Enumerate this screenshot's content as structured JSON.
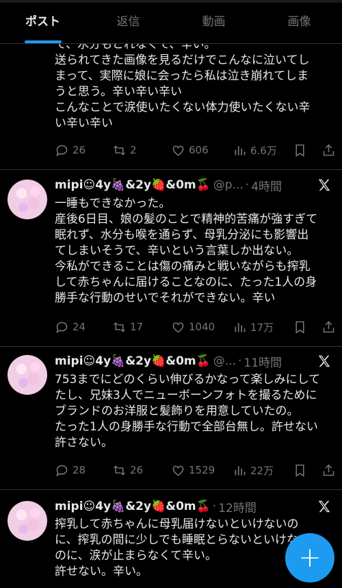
{
  "tabs": [
    {
      "label": "ポスト",
      "active": true
    },
    {
      "label": "返信"
    },
    {
      "label": "動画"
    },
    {
      "label": "画像"
    }
  ],
  "accent_color": "#1d9bf0",
  "posts": [
    {
      "text_lines": [
        "て、水分もとれなくて、辛い。",
        "送られてきた画像を見るだけでこんなに泣いてし",
        "まって、実際に娘に会ったら私は泣き崩れてしま",
        "うと思う。辛い辛い辛い",
        "こんなことで涙使いたくない体力使いたくない辛",
        "い辛い辛い"
      ],
      "replies": "26",
      "reposts": "2",
      "likes": "606",
      "views": "6.6万"
    },
    {
      "name": "mipi☺4y🍇&2y🍓&0m🍒",
      "handle": "@p...",
      "time": "4時間",
      "text_lines": [
        "一睡もできなかった。",
        "産後6日目、娘の髪のことで精神的苦痛が強すぎて",
        "眠れず、水分も喉を通らず、母乳分泌にも影響出",
        "てしまいそうで、辛いという言葉しか出ない。",
        "今私ができることは傷の痛みと戦いながらも搾乳",
        "して赤ちゃんに届けることなのに、たった1人の身",
        "勝手な行動のせいでそれができない。辛い"
      ],
      "replies": "24",
      "reposts": "17",
      "likes": "1040",
      "views": "17万"
    },
    {
      "name": "mipi☺4y🍇&2y🍓&0m🍒",
      "handle": "@...",
      "time": "11時間",
      "text_lines": [
        "753までにどのくらい伸びるかなって楽しみにして",
        "たし、兄妹3人でニューボーンフォトを撮るために",
        "ブランドのお洋服と髪飾りを用意していたの。",
        "たった1人の身勝手な行動で全部台無し。許せない",
        "許さない。"
      ],
      "replies": "28",
      "reposts": "26",
      "likes": "1529",
      "views": "22万"
    },
    {
      "name": "mipi☺4y🍇&2y🍓&0m🍒",
      "handle": "",
      "time": "12時間",
      "text_lines": [
        "搾乳して赤ちゃんに母乳届けないといけないの",
        "に、搾乳の間に少しでも睡眠とらないといけない",
        "のに、涙が止まらなくて辛い。",
        "許せない。辛い。"
      ]
    }
  ],
  "fab_label": "+"
}
